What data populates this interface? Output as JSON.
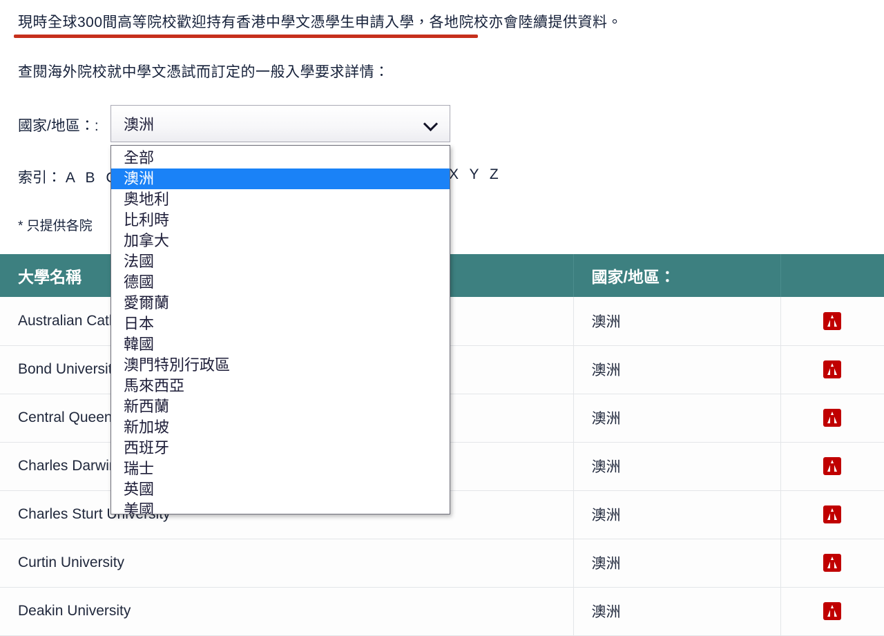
{
  "intro": {
    "line_1": "現時全球300間高等院校歡迎持有香港中學文憑學生申請入學，各地院校亦會陸續提供資料。",
    "line_2": "查閱海外院校就中學文憑試而訂定的一般入學要求詳情："
  },
  "form": {
    "country_label": "國家/地區：:",
    "index_label": "索引：",
    "index_letters_visible_start": "A B C",
    "index_letters_visible_end": "X Y Z",
    "footnote": "* 只提供各院"
  },
  "select": {
    "selected_value": "澳洲",
    "chevron_icon": "chevron-down-icon",
    "options": [
      "全部",
      "澳洲",
      "奧地利",
      "比利時",
      "加拿大",
      "法國",
      "德國",
      "愛爾蘭",
      "日本",
      "韓國",
      "澳門特別行政區",
      "馬來西亞",
      "新西蘭",
      "新加坡",
      "西班牙",
      "瑞士",
      "英國",
      "美國"
    ],
    "selected_index": 1
  },
  "table": {
    "headers": {
      "name": "大學名稱",
      "country": "國家/地區：",
      "doc": ""
    },
    "rows": [
      {
        "name": "Australian Catholic University",
        "country": "澳洲",
        "doc_icon": "pdf-icon"
      },
      {
        "name": "Bond University",
        "country": "澳洲",
        "doc_icon": "pdf-icon"
      },
      {
        "name": "Central Queensland University",
        "country": "澳洲",
        "doc_icon": "pdf-icon"
      },
      {
        "name": "Charles Darwin University",
        "country": "澳洲",
        "doc_icon": "pdf-icon"
      },
      {
        "name": "Charles Sturt University",
        "country": "澳洲",
        "doc_icon": "pdf-icon"
      },
      {
        "name": "Curtin University",
        "country": "澳洲",
        "doc_icon": "pdf-icon"
      },
      {
        "name": "Deakin University",
        "country": "澳洲",
        "doc_icon": "pdf-icon"
      }
    ]
  },
  "colors": {
    "header_teal": "#3d8080",
    "highlight_blue": "#1a82f7",
    "underline_red": "#c6301c",
    "pdf_red": "#c00000"
  }
}
